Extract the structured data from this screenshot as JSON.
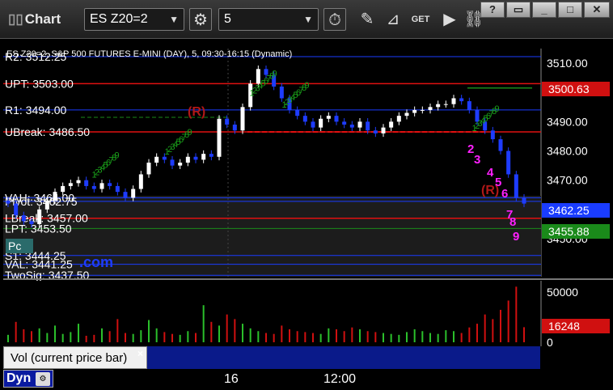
{
  "toolbar": {
    "window_title": "Chart",
    "symbol": "ES Z20=2",
    "interval": "5"
  },
  "chart_header": {
    "description": "ES Z20=2, S&P 500 FUTURES E-MINI (DAY), 5, 09:30-16:15 (Dynamic)"
  },
  "colors": {
    "up_candle": "#ffffff",
    "down_candle": "#1e3cff",
    "resistance_line": "#e01010",
    "support_line": "#1a8a1a",
    "level_line": "#1a3cff",
    "td_setup_green": "#1aa01a",
    "td_setup_magenta": "#ff20ff"
  },
  "levels": [
    {
      "label": "R2: 3512.25",
      "price": 3512.25
    },
    {
      "label": "UPT: 3503.00",
      "price": 3503.0
    },
    {
      "label": "R1: 3494.00",
      "price": 3494.0
    },
    {
      "label": "UBreak: 3486.50",
      "price": 3486.5
    },
    {
      "label": "VAH: 3464.00",
      "price": 3464.0
    },
    {
      "label": "Pivot: 3462.75",
      "price": 3462.75
    },
    {
      "label": "LBreak: 3457.00",
      "price": 3457.0
    },
    {
      "label": "LPT: 3453.50",
      "price": 3453.5
    },
    {
      "label": "S1: 3444.25",
      "price": 3444.25
    },
    {
      "label": "VAL: 3441.25",
      "price": 3441.25
    },
    {
      "label": "TwoSig: 3437.50",
      "price": 3437.5
    }
  ],
  "price_axis": {
    "ticks": [
      "3510.00",
      "3500.00",
      "3490.00",
      "3480.00",
      "3470.00",
      "3460.00",
      "3450.00"
    ],
    "tag_last": "3462.25",
    "tag_red": "3500.63",
    "tag_green": "3455.88"
  },
  "markers": {
    "R_left": "(R)",
    "R_right": "(R)",
    "magenta_counts": [
      "2",
      "3",
      "4",
      "5",
      "6",
      "7",
      "8",
      "9"
    ],
    "watermark": ".com",
    "pc_label": "Pc"
  },
  "volume": {
    "ticks": [
      "50000",
      "0"
    ],
    "last_value": "16248",
    "panel_label": "Vol (current price bar)",
    "close_glyph": "×"
  },
  "time_axis": {
    "labels": [
      "16",
      "12:00"
    ]
  },
  "bottom": {
    "dyn_label": "Dyn"
  },
  "chart_data": {
    "type": "candlestick",
    "ylim": [
      3437,
      3515
    ],
    "closes": [
      3462,
      3458,
      3456,
      3455,
      3460,
      3463,
      3466,
      3468,
      3469,
      3470,
      3468,
      3467,
      3469,
      3468,
      3466,
      3464,
      3467,
      3472,
      3476,
      3478,
      3477,
      3475,
      3476,
      3478,
      3477,
      3479,
      3478,
      3491,
      3489,
      3487,
      3495,
      3503,
      3508,
      3506,
      3502,
      3498,
      3494,
      3492,
      3490,
      3488,
      3491,
      3492,
      3490,
      3489,
      3488,
      3490,
      3487,
      3486,
      3488,
      3490,
      3492,
      3493,
      3494,
      3494,
      3495,
      3496,
      3496,
      3498,
      3497,
      3494,
      3490,
      3487,
      3484,
      3480,
      3472,
      3464,
      3462
    ],
    "volume": [
      8000,
      22000,
      14000,
      12000,
      15000,
      10000,
      18000,
      9000,
      11000,
      20000,
      7000,
      8000,
      15000,
      12000,
      25000,
      10000,
      9000,
      13000,
      24000,
      15000,
      11000,
      9000,
      8000,
      12000,
      10000,
      40000,
      22000,
      18000,
      30000,
      25000,
      20000,
      15000,
      12000,
      10000,
      9000,
      18000,
      14000,
      12000,
      11000,
      10000,
      9000,
      15000,
      14000,
      12000,
      16000,
      14000,
      12000,
      11000,
      10000,
      9000,
      8000,
      11000,
      14000,
      12000,
      10000,
      9000,
      13000,
      12000,
      10000,
      16000,
      20000,
      30000,
      25000,
      35000,
      45000,
      60000,
      16248
    ]
  }
}
